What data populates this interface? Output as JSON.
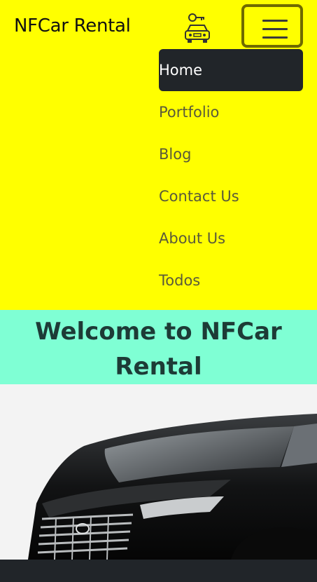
{
  "navbar": {
    "brand": "NFCar Rental",
    "brand_icon": "car-key-icon",
    "toggler_icon": "hamburger-menu-icon",
    "background": "#ffff00",
    "items": [
      {
        "label": "Home",
        "active": true
      },
      {
        "label": "Portfolio",
        "active": false
      },
      {
        "label": "Blog",
        "active": false
      },
      {
        "label": "Contact Us",
        "active": false
      },
      {
        "label": "About Us",
        "active": false
      },
      {
        "label": "Todos",
        "active": false
      }
    ]
  },
  "welcome": {
    "title": "Welcome to NFCar Rental",
    "background": "#7fffd4"
  },
  "hero": {
    "image": "black-minivan-image"
  }
}
